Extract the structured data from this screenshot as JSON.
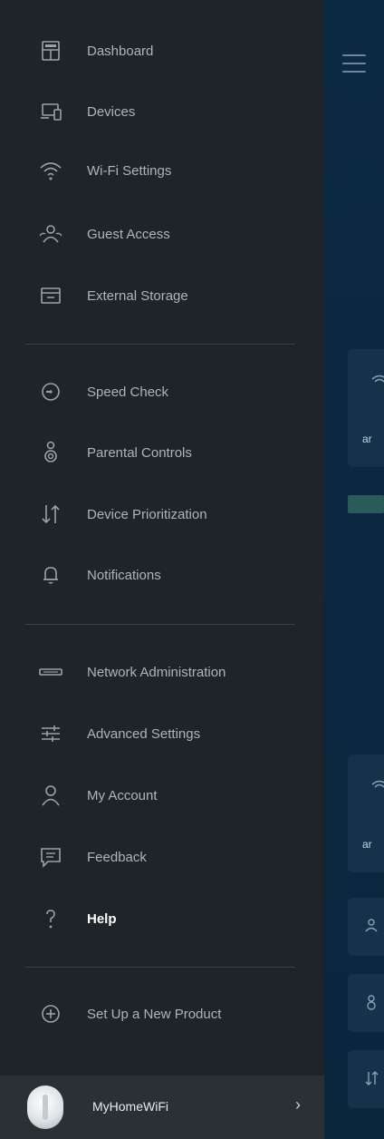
{
  "menu": {
    "group1": [
      {
        "label": "Dashboard",
        "icon": "dashboard-icon"
      },
      {
        "label": "Devices",
        "icon": "devices-icon"
      },
      {
        "label": "Wi-Fi Settings",
        "icon": "wifi-icon"
      },
      {
        "label": "Guest Access",
        "icon": "guest-access-icon"
      },
      {
        "label": "External Storage",
        "icon": "external-storage-icon"
      }
    ],
    "group2": [
      {
        "label": "Speed Check",
        "icon": "speedometer-icon"
      },
      {
        "label": "Parental Controls",
        "icon": "parental-controls-icon"
      },
      {
        "label": "Device Prioritization",
        "icon": "prioritization-arrows-icon"
      },
      {
        "label": "Notifications",
        "icon": "bell-icon"
      }
    ],
    "group3": [
      {
        "label": "Network Administration",
        "icon": "router-icon"
      },
      {
        "label": "Advanced Settings",
        "icon": "sliders-icon"
      },
      {
        "label": "My Account",
        "icon": "user-icon"
      },
      {
        "label": "Feedback",
        "icon": "feedback-icon"
      },
      {
        "label": "Help",
        "icon": "help-icon",
        "active": true
      }
    ],
    "group4": [
      {
        "label": "Set Up a New Product",
        "icon": "plus-circle-icon"
      }
    ]
  },
  "network": {
    "name": "MyHomeWiFi",
    "arrow": "›"
  },
  "background": {
    "card_text_1": "ar",
    "card_text_2": "ar"
  },
  "colors": {
    "drawer_bg": "#1f2428",
    "app_bg": "#0f2b42",
    "active_text": "#ffffff",
    "inactive_text": "#aeb4b8"
  }
}
